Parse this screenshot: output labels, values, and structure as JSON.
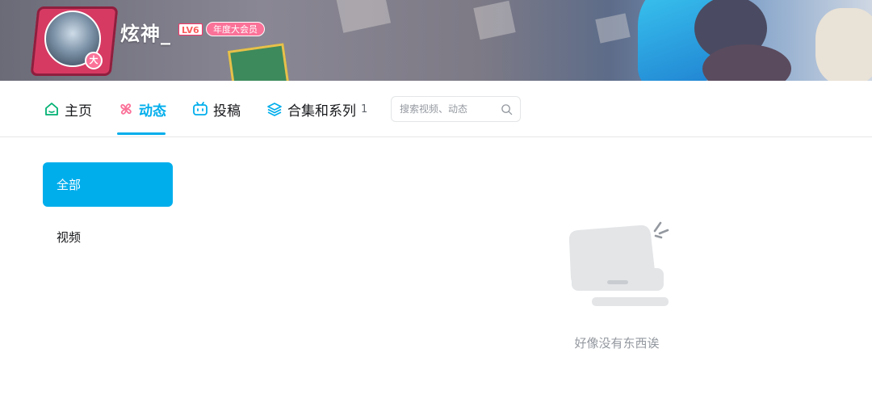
{
  "profile": {
    "username": "炫神_",
    "level": "LV6",
    "vip_label": "年度大会员",
    "avatar_badge": "大"
  },
  "nav": {
    "items": [
      {
        "label": "主页",
        "icon": "home-icon",
        "active": false
      },
      {
        "label": "动态",
        "icon": "dynamic-icon",
        "active": true
      },
      {
        "label": "投稿",
        "icon": "tv-icon",
        "active": false
      },
      {
        "label": "合集和系列",
        "icon": "layers-icon",
        "active": false,
        "count": "1"
      }
    ],
    "search_placeholder": "搜索视频、动态"
  },
  "sidebar": {
    "items": [
      {
        "label": "全部",
        "active": true
      },
      {
        "label": "视频",
        "active": false
      }
    ]
  },
  "empty_state": {
    "message": "好像没有东西诶"
  },
  "colors": {
    "accent": "#00aeec",
    "pink": "#fb7299",
    "text": "#18191c",
    "muted": "#9499a0"
  }
}
